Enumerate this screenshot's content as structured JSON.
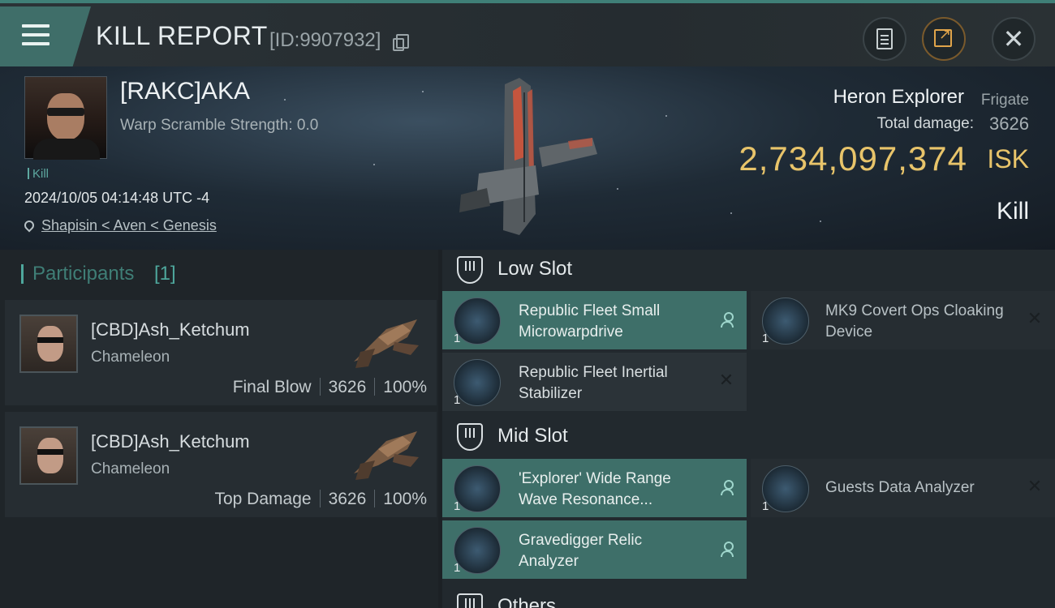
{
  "header": {
    "title": "KILL REPORT",
    "id_text": "[ID:9907932]"
  },
  "victim": {
    "name": "[RAKC]AKA",
    "warp_scramble": "Warp Scramble Strength: 0.0",
    "tag": "Kill",
    "timestamp": "2024/10/05 04:14:48 UTC -4",
    "location": "Shapisin < Aven < Genesis",
    "ship_name": "Heron Explorer",
    "ship_class": "Frigate",
    "total_damage_label": "Total damage:",
    "total_damage": "3626",
    "isk_value": "2,734,097,374",
    "isk_unit": "ISK",
    "result": "Kill"
  },
  "participants": {
    "title": "Participants",
    "count": "[1]",
    "items": [
      {
        "name": "[CBD]Ash_Ketchum",
        "ship": "Chameleon",
        "role": "Final Blow",
        "damage": "3626",
        "percent": "100%"
      },
      {
        "name": "[CBD]Ash_Ketchum",
        "ship": "Chameleon",
        "role": "Top Damage",
        "damage": "3626",
        "percent": "100%"
      }
    ]
  },
  "slots": {
    "low": {
      "label": "Low Slot",
      "modules": [
        {
          "name": "Republic Fleet Small Microwarpdrive",
          "qty": "1",
          "status": "dropped"
        },
        {
          "name": "MK9 Covert Ops Cloaking Device",
          "qty": "1",
          "status": "destroyed"
        },
        {
          "name": "Republic Fleet Inertial Stabilizer",
          "qty": "1",
          "status": "destroyed"
        }
      ]
    },
    "mid": {
      "label": "Mid Slot",
      "modules": [
        {
          "name": "'Explorer' Wide Range Wave Resonance...",
          "qty": "1",
          "status": "dropped"
        },
        {
          "name": "Guests Data Analyzer",
          "qty": "1",
          "status": "destroyed"
        },
        {
          "name": "Gravedigger Relic Analyzer",
          "qty": "1",
          "status": "dropped"
        }
      ]
    },
    "others": {
      "label": "Others"
    }
  },
  "icons": {
    "dropped": "person-icon",
    "destroyed": "close-icon"
  },
  "colors": {
    "accent": "#3f6e69",
    "isk": "#e8c46a",
    "dropped_bg": "#3e6f69"
  }
}
